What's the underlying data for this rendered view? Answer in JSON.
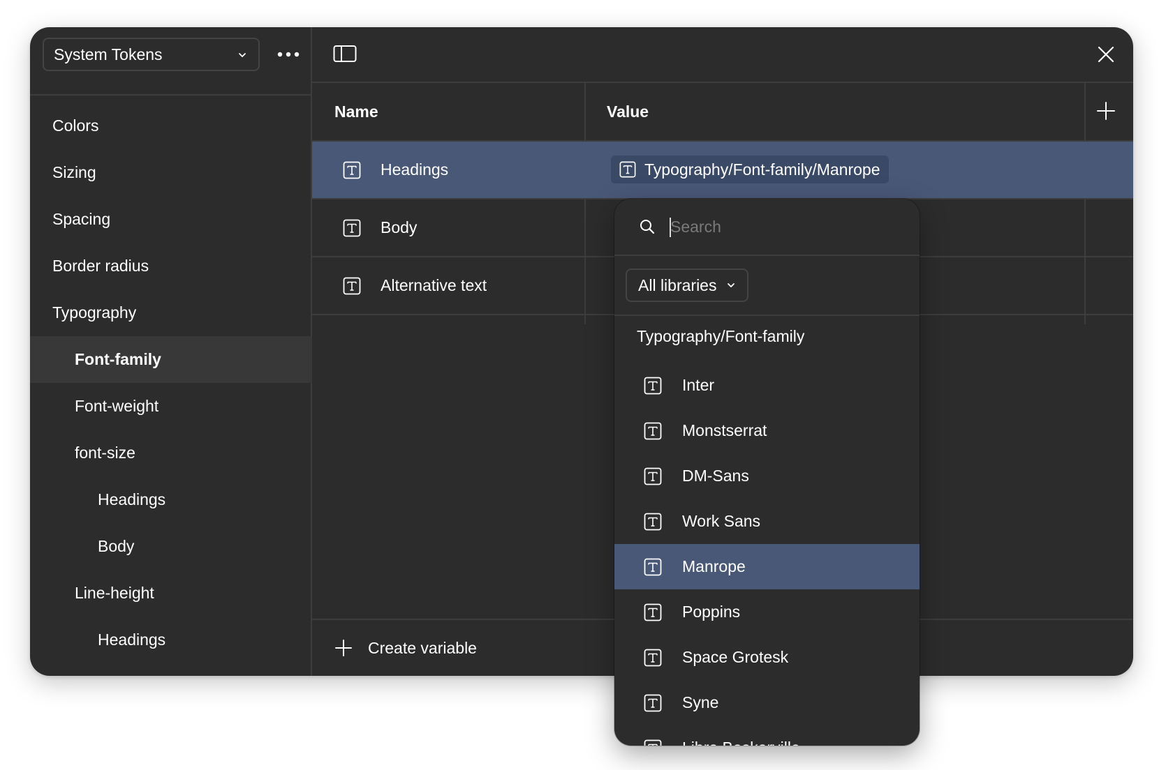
{
  "sidebar": {
    "collection_name": "System Tokens",
    "groups": [
      {
        "label": "Colors",
        "level": 0,
        "selected": false
      },
      {
        "label": "Sizing",
        "level": 0,
        "selected": false
      },
      {
        "label": "Spacing",
        "level": 0,
        "selected": false
      },
      {
        "label": "Border radius",
        "level": 0,
        "selected": false
      },
      {
        "label": "Typography",
        "level": 0,
        "selected": false
      },
      {
        "label": "Font-family",
        "level": 1,
        "selected": true
      },
      {
        "label": "Font-weight",
        "level": 1,
        "selected": false
      },
      {
        "label": "font-size",
        "level": 1,
        "selected": false
      },
      {
        "label": "Headings",
        "level": 2,
        "selected": false
      },
      {
        "label": "Body",
        "level": 2,
        "selected": false
      },
      {
        "label": "Line-height",
        "level": 1,
        "selected": false
      },
      {
        "label": "Headings",
        "level": 2,
        "selected": false
      }
    ]
  },
  "table": {
    "columns": {
      "name": "Name",
      "value": "Value"
    },
    "rows": [
      {
        "name": "Headings",
        "value": "Typography/Font-family/Manrope",
        "selected": true
      },
      {
        "name": "Body",
        "value": "",
        "selected": false
      },
      {
        "name": "Alternative text",
        "value": "",
        "selected": false
      }
    ]
  },
  "footer": {
    "create_label": "Create variable"
  },
  "dropdown": {
    "search_placeholder": "Search",
    "search_value": "",
    "library_filter": "All libraries",
    "group_heading": "Typography/Font-family",
    "options": [
      {
        "label": "Inter",
        "highlighted": false
      },
      {
        "label": "Monstserrat",
        "highlighted": false
      },
      {
        "label": "DM-Sans",
        "highlighted": false
      },
      {
        "label": "Work Sans",
        "highlighted": false
      },
      {
        "label": "Manrope",
        "highlighted": true
      },
      {
        "label": "Poppins",
        "highlighted": false
      },
      {
        "label": "Space Grotesk",
        "highlighted": false
      },
      {
        "label": "Syne",
        "highlighted": false
      },
      {
        "label": "Libre Baskerville",
        "highlighted": false
      }
    ]
  },
  "colors": {
    "window_bg": "#2c2c2c",
    "selection": "#4a5878",
    "chip": "#3a4966",
    "divider": "#3d3d3d"
  }
}
